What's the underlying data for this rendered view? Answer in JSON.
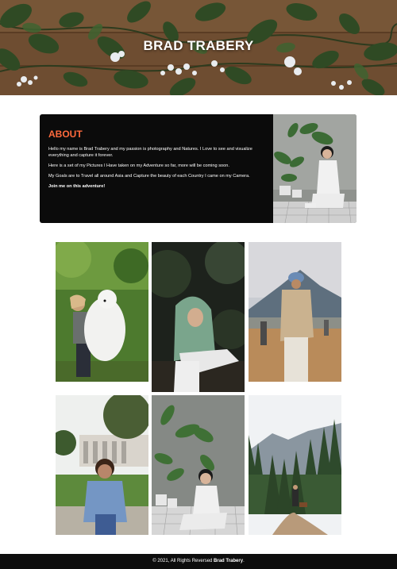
{
  "hero": {
    "title": "BRAD TRABERY"
  },
  "about": {
    "heading": "ABOUT",
    "paragraphs": [
      "Hello my name is Brad Trabery and my passion is photography and Natures. I Love to see and visualize everything and capture it forever.",
      "Here is a set of my Pictures I Have taken on my Adventure so far, more will be coming soon.",
      "My Goals are to Travel all around Asia and Capture the beauty of each Country I came on my Camera."
    ],
    "closing": "Join me on this adventure!",
    "photo_icon": "woman-with-plants-photo"
  },
  "gallery": {
    "photos": [
      {
        "name": "woman-with-white-dog-photo"
      },
      {
        "name": "woman-in-hijab-photo"
      },
      {
        "name": "man-walking-toward-mountain-photo"
      },
      {
        "name": "smiling-woman-denim-jacket-photo"
      },
      {
        "name": "woman-with-plants-photo"
      },
      {
        "name": "hiker-with-dog-forest-photo"
      }
    ]
  },
  "footer": {
    "copyright": "© 2021, All Rights Reversed",
    "owner": "Brad Trabery",
    "period": "."
  },
  "colors": {
    "accent": "#ff6a3d",
    "card_bg": "#0b0b0b",
    "footer_bg": "#0d0d0d"
  }
}
